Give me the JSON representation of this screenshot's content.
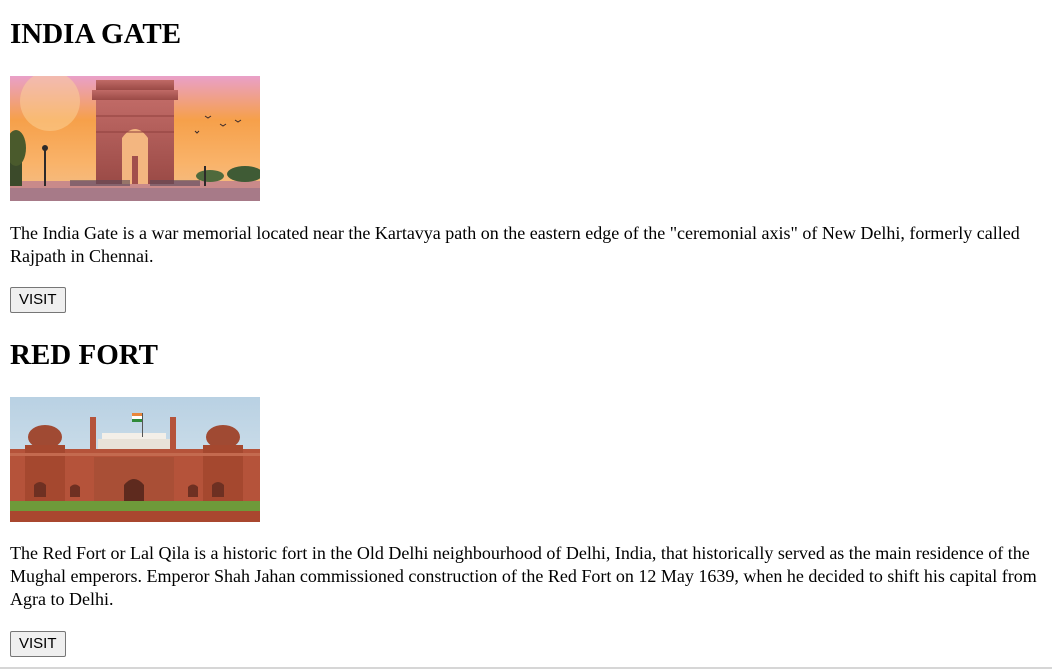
{
  "places": [
    {
      "title": "INDIA GATE",
      "description": "The India Gate is a war memorial located near the Kartavya path on the eastern edge of the \"ceremonial axis\" of New Delhi, formerly called Rajpath in Chennai.",
      "button_label": "VISIT",
      "image_icon": "india-gate-photo"
    },
    {
      "title": "RED FORT",
      "description": "The Red Fort or Lal Qila is a historic fort in the Old Delhi neighbourhood of Delhi, India, that historically served as the main residence of the Mughal emperors. Emperor Shah Jahan commissioned construction of the Red Fort on 12 May 1639, when he decided to shift his capital from Agra to Delhi.",
      "button_label": "VISIT",
      "image_icon": "red-fort-photo"
    }
  ],
  "colors": {
    "button_bg": "#efefef",
    "button_border": "#767676",
    "gate_stone": "#b85a52",
    "fort_stone": "#b5533a",
    "sunset_sky": "#f6a04a"
  }
}
